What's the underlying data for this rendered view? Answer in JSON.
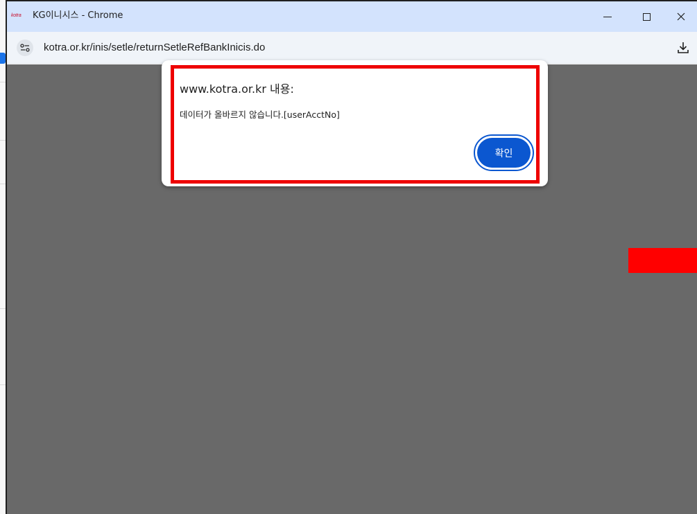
{
  "window": {
    "favicon_text": "kotra",
    "title": "KG이니시스 - Chrome",
    "minimize_icon": "minimize-icon",
    "maximize_icon": "maximize-icon",
    "close_icon": "close-icon"
  },
  "addressbar": {
    "site_info_icon": "site-info-icon",
    "url": "kotra.or.kr/inis/setle/returnSetleRefBankInicis.do",
    "download_icon": "download-icon"
  },
  "dialog": {
    "title": "www.kotra.or.kr 내용:",
    "message": "데이터가 올바르지 않습니다.[userAcctNo]",
    "ok_label": "확인"
  },
  "colors": {
    "titlebar": "#d3e3fd",
    "addressbar": "#f0f4f9",
    "overlay": "#696969",
    "highlight": "#ee0000",
    "button": "#0b57d0"
  }
}
